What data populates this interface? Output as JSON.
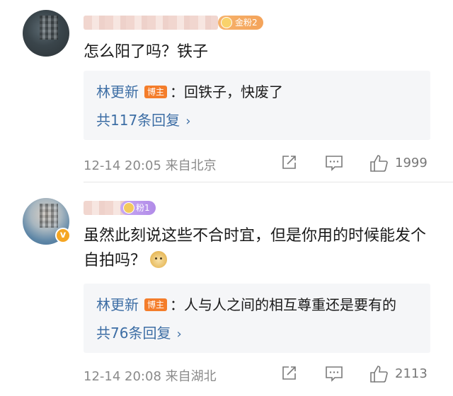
{
  "comments": [
    {
      "username": "",
      "fan_badge": "金粉2",
      "text": "怎么阳了吗？铁子",
      "reply": {
        "author": "林更新",
        "author_tag": "博主",
        "text": "：回铁子，快废了",
        "count_label": "共117条回复"
      },
      "time": "12-14 20:05",
      "location": "来自北京",
      "likes": "1999"
    },
    {
      "username": "",
      "fan_badge": "粉1",
      "text": "虽然此刻说这些不合时宜，但是你用的时候能发个自拍吗？",
      "reply": {
        "author": "林更新",
        "author_tag": "博主",
        "text": "：人与人之间的相互尊重还是要有的",
        "count_label": "共76条回复"
      },
      "time": "12-14 20:08",
      "location": "来自湖北",
      "likes": "2113"
    }
  ],
  "icons": {
    "share": "share-icon",
    "reply": "comment-icon",
    "like": "thumbs-up-icon",
    "chevron": "chevron-right-icon",
    "emoji": "doge-emoji-icon"
  },
  "colors": {
    "link_blue": "#3d6ea5",
    "blogger_orange": "#f47d2b",
    "reply_bg": "#f5f6f8",
    "meta_gray": "#8a8a8a"
  }
}
